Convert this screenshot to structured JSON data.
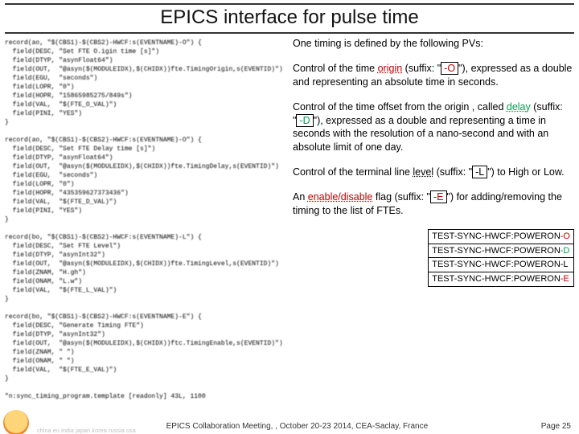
{
  "title": "EPICS interface for pulse time",
  "code_blocks": [
    "record(ao, \"$(CBS1)-$(CBS2)-HWCF:s(EVENTNAME)-O\") {",
    "  field(DESC, \"Set FTE O.igin time [s]\")",
    "  field(DTYP, \"asynFloat64\")",
    "  field(OUT,  \"@asyn($(MODULEIDX),$(CHIDX))fte.TimingOrigin,s(EVENTID)\")",
    "  field(EGU,  \"seconds\")",
    "  field(LOPR, \"0\")",
    "  field(HOPR, \"15865985275/849s\")",
    "  field(VAL,  \"$(FTE_O_VAL)\")",
    "  field(PINI, \"YES\")",
    "}",
    "",
    "record(ao, \"$(CBS1)-$(CBS2)-HWCF:s(EVENTNAME)-O\") {",
    "  field(DESC, \"Set FTE Delay time [s]\")",
    "  field(DTYP, \"asynFloat64\")",
    "  field(OUT,  \"@asyn($(MODULEIDX),$(CHIDX))fte.TimingDelay,s(EVENTID)\")",
    "  field(EGU,  \"seconds\")",
    "  field(LOPR, \"0\")",
    "  field(HOPR, \"435359627373436\")",
    "  field(VAL,  \"$(FTE_D_VAL)\")",
    "  field(PINI, \"YES\")",
    "}",
    "",
    "record(bo, \"$(CBS1)-$(CBS2)-HWCF:s(EVENTNAME)-L\") {",
    "  field(DESC, \"Set FTE Level\")",
    "  field(DTYP, \"asynInt32\")",
    "  field(OUT,  \"@asyn($(MODULEIDX),$(CHIDX))fte.TimingLevel,s(EVENTID)\")",
    "  field(ZNAM, \"H.gh\")",
    "  field(ONAM, \"L.w\")",
    "  field(VAL,  \"$(FTE_L_VAL)\")",
    "}",
    "",
    "record(bo, \"$(CBS1)-$(CBS2)-HWCF:s(EVENTNAME)-E\") {",
    "  field(DESC, \"Generate Timing FTE\")",
    "  field(DTYP, \"asynInt32\")",
    "  field(OUT,  \"@asyn($(MODULEIDX),$(CHIDX))ftc.TimingEnable,s(EVENTID)\")",
    "  field(ZNAM, \" \")",
    "  field(ONAM, \" \")",
    "  field(VAL,  \"$(FTE_E_VAL)\")",
    "}",
    "",
    "\"n:sync_timing_program.template [readonly] 43L, 1100"
  ],
  "paragraphs": {
    "intro": "One timing is defined by the following PVs:",
    "origin": {
      "pre": "Control of the time ",
      "kw": "origin",
      "post": " (suffix: \"",
      "suffix": "-O",
      "tail": "\"), expressed as a double and representing an absolute time in seconds."
    },
    "delay": {
      "pre": "Control of the time offset from the origin , called ",
      "kw": "delay",
      "post": " (suffix: \"",
      "suffix": "-D",
      "tail": "\"), expressed as a double and representing a time in seconds with the resolution of a nano-second and with an absolute limit of one day."
    },
    "level": {
      "pre": "Control of the terminal line ",
      "kw": "level",
      "post": " (suffix: \"",
      "suffix": "-L",
      "tail": "\") to High or Low."
    },
    "enable": {
      "pre": "An ",
      "kw": "enable/disable",
      "post": " flag (suffix: \"",
      "suffix": "-E",
      "tail": "\") for adding/removing the timing to the list of FTEs."
    }
  },
  "pv_table": {
    "prefix": "TEST-SYNC-HWCF:",
    "name": "POWERON",
    "rows": [
      {
        "suffix": "-O",
        "cls": "pv-red"
      },
      {
        "suffix": "-D",
        "cls": "pv-green"
      },
      {
        "suffix": "-L",
        "cls": ""
      },
      {
        "suffix": "-E",
        "cls": "pv-red"
      }
    ]
  },
  "footer": {
    "countries": "china eu india japan korea russia usa",
    "center": "EPICS Collaboration Meeting, , October 20-23 2014, CEA-Saclay, France",
    "page": "Page 25"
  }
}
